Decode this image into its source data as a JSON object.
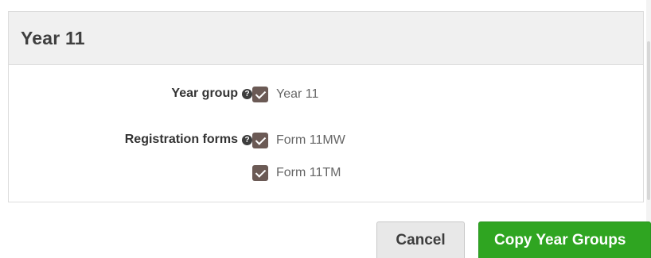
{
  "panel": {
    "title": "Year 11"
  },
  "fields": {
    "year_group": {
      "label": "Year group",
      "options": [
        {
          "label": "Year 11",
          "checked": true
        }
      ]
    },
    "registration_forms": {
      "label": "Registration forms",
      "options": [
        {
          "label": "Form 11MW",
          "checked": true
        },
        {
          "label": "Form 11TM",
          "checked": true
        }
      ]
    }
  },
  "icons": {
    "help": "help-circle-icon",
    "check": "checkmark-icon"
  },
  "help_glyph": "?",
  "colors": {
    "checkbox": "#6b5a55",
    "primary_button": "#2fa521",
    "secondary_button": "#e8e8e8",
    "header_bg": "#f0f0f0"
  },
  "actions": {
    "cancel_label": "Cancel",
    "copy_label": "Copy Year Groups"
  }
}
